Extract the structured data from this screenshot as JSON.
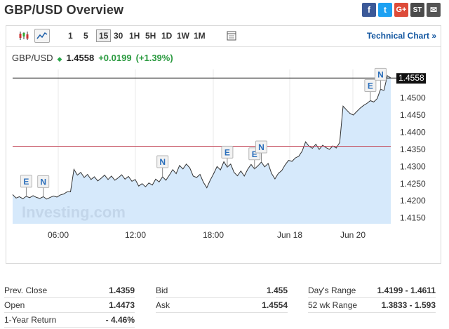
{
  "page": {
    "title": "GBP/USD Overview"
  },
  "share": [
    {
      "name": "facebook",
      "glyph": "f"
    },
    {
      "name": "twitter",
      "glyph": "t"
    },
    {
      "name": "google-plus",
      "glyph": "G+"
    },
    {
      "name": "stocktwits",
      "glyph": "ST"
    },
    {
      "name": "email",
      "glyph": "✉"
    }
  ],
  "toolbar": {
    "intervals": [
      "1",
      "5",
      "15",
      "30",
      "1H",
      "5H",
      "1D",
      "1W",
      "1M"
    ],
    "active_interval": "15",
    "technical_chart_label": "Technical Chart »"
  },
  "quote": {
    "symbol": "GBP/USD",
    "last": "1.4558",
    "change": "+0.0199",
    "change_pct": "(+1.39%)",
    "up_color": "#2a9a3f"
  },
  "chart_data": {
    "type": "area",
    "y_ticks": [
      "1.4500",
      "1.4450",
      "1.4400",
      "1.4350",
      "1.4300",
      "1.4250",
      "1.4200",
      "1.4150"
    ],
    "x_tick_labels": [
      "06:00",
      "12:00",
      "18:00",
      "Jun 18",
      "Jun 20"
    ],
    "ylim": [
      1.4133,
      1.4583
    ],
    "last_value": 1.4558,
    "last_label": "1.4558",
    "prev_close": 1.4359,
    "watermark": "Investing.com",
    "series": [
      {
        "values": [
          1.4218,
          1.4208,
          1.4212,
          1.4206,
          1.4213,
          1.4209,
          1.4215,
          1.421,
          1.4207,
          1.4212,
          1.4205,
          1.421,
          1.4214,
          1.4211,
          1.4217,
          1.422,
          1.4226,
          1.4226,
          1.4292,
          1.4275,
          1.4283,
          1.4268,
          1.4277,
          1.4262,
          1.427,
          1.4258,
          1.4266,
          1.4275,
          1.4262,
          1.4272,
          1.426,
          1.4267,
          1.4276,
          1.4263,
          1.4271,
          1.4257,
          1.4262,
          1.4243,
          1.425,
          1.4241,
          1.4252,
          1.4246,
          1.4263,
          1.4255,
          1.427,
          1.426,
          1.4275,
          1.4291,
          1.4279,
          1.4303,
          1.4293,
          1.4307,
          1.4296,
          1.4272,
          1.4268,
          1.4277,
          1.4254,
          1.4238,
          1.426,
          1.4279,
          1.43,
          1.429,
          1.4314,
          1.4298,
          1.4307,
          1.4283,
          1.4273,
          1.4287,
          1.4272,
          1.4292,
          1.4306,
          1.4293,
          1.4302,
          1.4313,
          1.4299,
          1.4309,
          1.428,
          1.4264,
          1.428,
          1.4288,
          1.4305,
          1.4318,
          1.4315,
          1.4325,
          1.433,
          1.4345,
          1.4372,
          1.4359,
          1.4353,
          1.4365,
          1.435,
          1.4362,
          1.4355,
          1.435,
          1.436,
          1.4354,
          1.437,
          1.4476,
          1.4465,
          1.4455,
          1.445,
          1.446,
          1.447,
          1.4478,
          1.4484,
          1.4492,
          1.4488,
          1.4498,
          1.4525,
          1.4522,
          1.4565,
          1.4558
        ]
      }
    ],
    "events": [
      {
        "label": "E",
        "index": 4
      },
      {
        "label": "N",
        "index": 9
      },
      {
        "label": "N",
        "index": 44
      },
      {
        "label": "E",
        "index": 63
      },
      {
        "label": "E",
        "index": 71
      },
      {
        "label": "N",
        "index": 73
      },
      {
        "label": "E",
        "index": 105
      },
      {
        "label": "N",
        "index": 108
      }
    ],
    "colors": {
      "line": "#333333",
      "fill": "#d6e9fb",
      "prev_close": "#c44d5e",
      "last_line": "#222222",
      "grid": "#e9e9e9"
    }
  },
  "stats": [
    [
      {
        "label": "Prev. Close",
        "value": "1.4359"
      },
      {
        "label": "Open",
        "value": "1.4473"
      },
      {
        "label": "1-Year Return",
        "value": "- 4.46%"
      }
    ],
    [
      {
        "label": "Bid",
        "value": "1.455"
      },
      {
        "label": "Ask",
        "value": "1.4554"
      }
    ],
    [
      {
        "label": "Day's Range",
        "value": "1.4199 - 1.4611"
      },
      {
        "label": "52 wk Range",
        "value": "1.3833 - 1.593"
      }
    ]
  ]
}
